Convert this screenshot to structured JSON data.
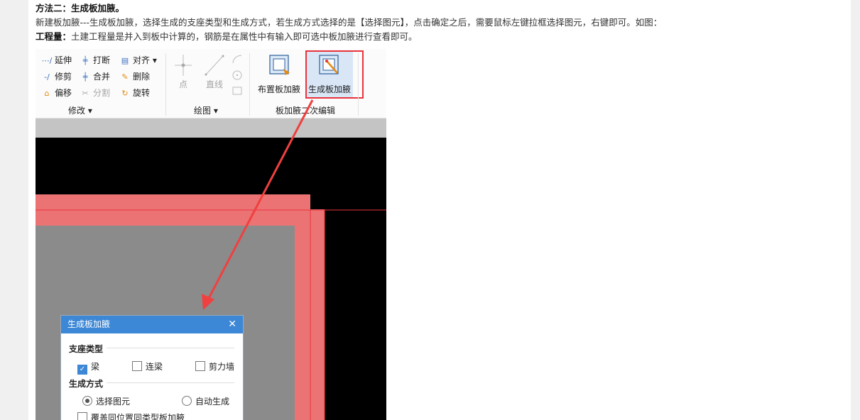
{
  "article": {
    "heading": "方法二：生成板加腋。",
    "line2": "新建板加腋---生成板加腋，选择生成的支座类型和生成方式，若生成方式选择的是【选择图元】，点击确定之后，需要鼠标左键拉框选择图元，右键即可。如图：",
    "line3_bold": "工程量：",
    "line3_rest": "土建工程量是并入到板中计算的，钢筋是在属性中有输入即可选中板加腋进行查看即可。"
  },
  "ribbon": {
    "modify": {
      "extend": "延伸",
      "break": "打断",
      "align": "对齐",
      "trim": "修剪",
      "merge": "合并",
      "delete": "删除",
      "offset": "偏移",
      "split": "分割",
      "rotate": "旋转",
      "group_label": "修改"
    },
    "draw": {
      "point": "点",
      "line": "直线",
      "group_label": "绘图"
    },
    "haunch": {
      "place_label": "布置板加腋",
      "generate_label": "生成板加腋",
      "group_label": "板加腋二次编辑"
    }
  },
  "dialog": {
    "title": "生成板加腋",
    "support_type_title": "支座类型",
    "support_types": [
      {
        "label": "梁",
        "checked": true
      },
      {
        "label": "连梁",
        "checked": false
      },
      {
        "label": "剪力墙",
        "checked": false
      }
    ],
    "method_title": "生成方式",
    "methods": [
      {
        "label": "选择图元",
        "selected": true
      },
      {
        "label": "自动生成",
        "selected": false
      }
    ],
    "overwrite_label": "覆盖同位置同类型板加腋"
  },
  "colors": {
    "accent": "#3c87d6",
    "highlight": "#e8333c",
    "slab": "#ec7373",
    "gray_fill": "#8b8b8b"
  }
}
